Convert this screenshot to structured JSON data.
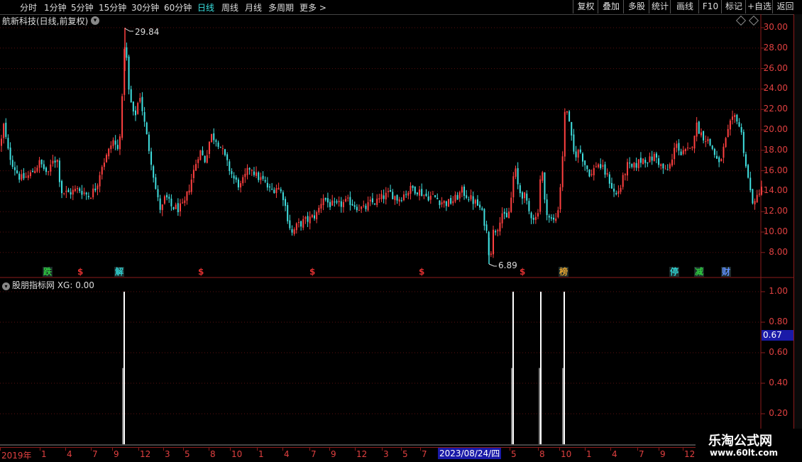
{
  "toolbar": {
    "timeframes": [
      "分时",
      "1分钟",
      "5分钟",
      "15分钟",
      "30分钟",
      "60分钟",
      "日线",
      "周线",
      "月线",
      "多周期",
      "更多 >"
    ],
    "active_timeframe": "日线",
    "right_buttons": [
      "复权",
      "叠加",
      "多股",
      "统计",
      "画线",
      "F10",
      "标记",
      "+自选",
      "返回"
    ]
  },
  "stock": {
    "title": "航新科技(日线,前复权)"
  },
  "price_axis": {
    "ticks": [
      "30.00",
      "28.00",
      "26.00",
      "24.00",
      "22.00",
      "20.00",
      "18.00",
      "16.00",
      "14.00",
      "12.00",
      "10.00",
      "8.00"
    ]
  },
  "annotations": {
    "high_label": "29.84",
    "low_label": "6.89"
  },
  "events": [
    {
      "text": "跌",
      "color": "#2ecc40",
      "box": true
    },
    {
      "text": "$",
      "color": "#e03030",
      "box": false
    },
    {
      "text": "解",
      "color": "#30d0d0",
      "box": true
    },
    {
      "text": "$",
      "color": "#e03030",
      "box": false
    },
    {
      "text": "$",
      "color": "#e03030",
      "box": false
    },
    {
      "text": "$",
      "color": "#e03030",
      "box": false
    },
    {
      "text": "$",
      "color": "#e03030",
      "box": false
    },
    {
      "text": "榜",
      "color": "#e0a030",
      "box": true
    },
    {
      "text": "停",
      "color": "#30d0d0",
      "box": true
    },
    {
      "text": "减",
      "color": "#2ecc40",
      "box": true
    },
    {
      "text": "财",
      "color": "#6090ff",
      "box": true
    }
  ],
  "indicator": {
    "header": "股朋指标网  XG: 0.00",
    "ticks": [
      "1.00",
      "0.80",
      "0.67",
      "0.60",
      "0.40",
      "0.20"
    ],
    "current_value": "0.67"
  },
  "date_axis": {
    "labels": [
      "2019年",
      "1",
      "4",
      "7",
      "9",
      "12",
      "3",
      "5",
      "8",
      "10",
      "1",
      "4",
      "7",
      "9",
      "12",
      "3",
      "5",
      "7",
      "5",
      "8",
      "10",
      "1",
      "4",
      "7",
      "9",
      "12"
    ],
    "cursor_date": "2023/08/24/四"
  },
  "watermark": {
    "title": "乐淘公式网",
    "url": "www.60lt.com"
  },
  "colors": {
    "up": "#ff4040",
    "down": "#40e0e0",
    "axis": "#8b1c1c",
    "grid": "#5a1010"
  },
  "chart_data": {
    "type": "candlestick",
    "title": "航新科技(日线,前复权)",
    "ylim": [
      6.0,
      31.0
    ],
    "price_path": [
      [
        0,
        18.5
      ],
      [
        4,
        20.5
      ],
      [
        10,
        18.0
      ],
      [
        18,
        16.5
      ],
      [
        28,
        15.2
      ],
      [
        40,
        15.5
      ],
      [
        55,
        16.8
      ],
      [
        68,
        15.5
      ],
      [
        72,
        17.2
      ],
      [
        80,
        17.0
      ],
      [
        85,
        14.0
      ],
      [
        95,
        13.8
      ],
      [
        110,
        14.2
      ],
      [
        125,
        13.5
      ],
      [
        135,
        14.5
      ],
      [
        142,
        16.5
      ],
      [
        150,
        17.5
      ],
      [
        158,
        19.0
      ],
      [
        165,
        18.0
      ],
      [
        170,
        21.0
      ],
      [
        175,
        29.5
      ],
      [
        180,
        24.0
      ],
      [
        188,
        21.0
      ],
      [
        196,
        23.5
      ],
      [
        204,
        20.0
      ],
      [
        212,
        17.0
      ],
      [
        220,
        13.5
      ],
      [
        226,
        12.0
      ],
      [
        232,
        13.5
      ],
      [
        240,
        12.5
      ],
      [
        250,
        12.3
      ],
      [
        258,
        12.5
      ],
      [
        266,
        14.5
      ],
      [
        272,
        16.0
      ],
      [
        280,
        18.0
      ],
      [
        288,
        17.0
      ],
      [
        296,
        19.5
      ],
      [
        305,
        19.0
      ],
      [
        312,
        18.0
      ],
      [
        320,
        16.5
      ],
      [
        330,
        15.0
      ],
      [
        338,
        14.5
      ],
      [
        345,
        15.5
      ],
      [
        352,
        16.5
      ],
      [
        360,
        15.5
      ],
      [
        370,
        15.0
      ],
      [
        380,
        14.0
      ],
      [
        390,
        14.5
      ],
      [
        398,
        13.5
      ],
      [
        404,
        11.5
      ],
      [
        410,
        9.8
      ],
      [
        416,
        10.5
      ],
      [
        426,
        11.0
      ],
      [
        436,
        11.3
      ],
      [
        446,
        11.8
      ],
      [
        454,
        13.5
      ],
      [
        462,
        12.8
      ],
      [
        472,
        12.5
      ],
      [
        482,
        12.8
      ],
      [
        492,
        13.0
      ],
      [
        502,
        12.5
      ],
      [
        512,
        12.2
      ],
      [
        520,
        12.8
      ],
      [
        530,
        13.0
      ],
      [
        540,
        13.5
      ],
      [
        550,
        13.8
      ],
      [
        560,
        13.2
      ],
      [
        570,
        13.8
      ],
      [
        580,
        14.3
      ],
      [
        590,
        14.0
      ],
      [
        600,
        13.5
      ],
      [
        610,
        13.5
      ],
      [
        620,
        13.0
      ],
      [
        630,
        12.8
      ],
      [
        640,
        13.2
      ],
      [
        650,
        14.0
      ],
      [
        658,
        13.5
      ],
      [
        666,
        13.0
      ],
      [
        674,
        12.5
      ],
      [
        680,
        11.5
      ],
      [
        686,
        9.5
      ],
      [
        689,
        7.2
      ],
      [
        694,
        10.0
      ],
      [
        700,
        10.5
      ],
      [
        706,
        12.0
      ],
      [
        712,
        11.0
      ],
      [
        718,
        12.5
      ],
      [
        724,
        16.5
      ],
      [
        730,
        14.0
      ],
      [
        738,
        13.5
      ],
      [
        744,
        12.0
      ],
      [
        750,
        11.5
      ],
      [
        756,
        11.3
      ],
      [
        762,
        17.0
      ],
      [
        766,
        13.0
      ],
      [
        772,
        11.5
      ],
      [
        778,
        11.0
      ],
      [
        784,
        11.5
      ],
      [
        790,
        15.5
      ],
      [
        796,
        23.0
      ],
      [
        802,
        20.0
      ],
      [
        808,
        17.5
      ],
      [
        816,
        18.0
      ],
      [
        824,
        16.5
      ],
      [
        832,
        15.5
      ],
      [
        840,
        16.8
      ],
      [
        850,
        16.0
      ],
      [
        858,
        15.0
      ],
      [
        866,
        13.5
      ],
      [
        874,
        14.5
      ],
      [
        882,
        16.5
      ],
      [
        890,
        16.2
      ],
      [
        898,
        16.8
      ],
      [
        906,
        17.2
      ],
      [
        914,
        17.0
      ],
      [
        922,
        17.5
      ],
      [
        930,
        16.5
      ],
      [
        938,
        15.8
      ],
      [
        946,
        17.0
      ],
      [
        952,
        19.0
      ],
      [
        958,
        17.5
      ],
      [
        964,
        17.8
      ],
      [
        972,
        18.0
      ],
      [
        980,
        20.5
      ],
      [
        988,
        19.5
      ],
      [
        996,
        19.0
      ],
      [
        1004,
        18.0
      ],
      [
        1012,
        16.5
      ],
      [
        1020,
        18.5
      ],
      [
        1028,
        20.5
      ],
      [
        1036,
        21.5
      ],
      [
        1044,
        19.5
      ],
      [
        1050,
        16.5
      ],
      [
        1056,
        14.0
      ],
      [
        1062,
        12.5
      ],
      [
        1068,
        14.0
      ],
      [
        1072,
        14.5
      ]
    ],
    "xg_signals": [
      {
        "x": 175,
        "value": 1.0
      },
      {
        "x": 723,
        "value": 1.0
      },
      {
        "x": 762,
        "value": 1.0
      },
      {
        "x": 795,
        "value": 1.0
      }
    ],
    "indicator_ylim": [
      0,
      1.1
    ]
  }
}
